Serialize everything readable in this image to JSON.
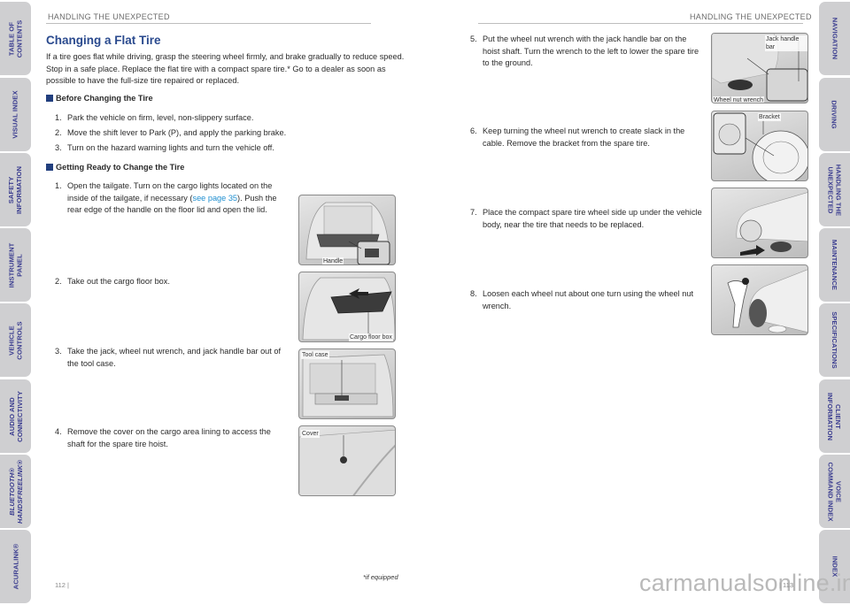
{
  "left_tabs": [
    {
      "label": "TABLE OF\nCONTENTS"
    },
    {
      "label": "VISUAL INDEX"
    },
    {
      "label": "SAFETY\nINFORMATION"
    },
    {
      "label": "INSTRUMENT\nPANEL"
    },
    {
      "label": "VEHICLE\nCONTROLS"
    },
    {
      "label": "AUDIO AND\nCONNECTIVITY"
    },
    {
      "label": "BLUETOOTH®\nHANDSFREELINK®"
    },
    {
      "label": "ACURALINK®"
    }
  ],
  "right_tabs": [
    {
      "label": "NAVIGATION"
    },
    {
      "label": "DRIVING"
    },
    {
      "label": "HANDLING THE\nUNEXPECTED"
    },
    {
      "label": "MAINTENANCE"
    },
    {
      "label": "SPECIFICATIONS"
    },
    {
      "label": "CLIENT\nINFORMATION"
    },
    {
      "label": "VOICE\nCOMMAND INDEX"
    },
    {
      "label": "INDEX"
    }
  ],
  "left_page": {
    "running_header": "HANDLING THE UNEXPECTED",
    "title": "Changing a Flat Tire",
    "intro": "If a tire goes flat while driving, grasp the steering wheel firmly, and brake gradually to reduce speed. Stop in a safe place. Replace the flat tire with a compact spare tire.* Go to a dealer as soon as possible to have the full-size tire repaired or replaced.",
    "section1": {
      "heading": "Before Changing the Tire",
      "steps": [
        {
          "num": "1.",
          "text": "Park the vehicle on firm, level, non-slippery surface."
        },
        {
          "num": "2.",
          "text": "Move the shift lever to Park (P), and apply the parking brake."
        },
        {
          "num": "3.",
          "text": "Turn on the hazard warning lights and turn the vehicle off."
        }
      ]
    },
    "section2": {
      "heading": "Getting Ready to Change the Tire",
      "steps": [
        {
          "num": "1.",
          "text_a": "Open the tailgate. Turn on the cargo lights located on the inside of the tailgate, if necessary (",
          "link": "see page 35",
          "text_b": "). Push the rear edge of the handle on the floor lid and open the lid.",
          "figure_label": "Handle"
        },
        {
          "num": "2.",
          "text": "Take out the cargo floor box.",
          "figure_label": "Cargo floor box"
        },
        {
          "num": "3.",
          "text": "Take the jack, wheel nut wrench, and jack handle bar out of the tool case.",
          "figure_label": "Tool case"
        },
        {
          "num": "4.",
          "text": "Remove the cover on the cargo area lining to access the shaft for the spare tire hoist.",
          "figure_label": "Cover"
        }
      ]
    },
    "footnote": "*if equipped",
    "page_number": "112  |"
  },
  "right_page": {
    "running_header": "HANDLING THE UNEXPECTED",
    "steps": [
      {
        "num": "5.",
        "text": "Put the wheel nut wrench with the jack handle bar on the hoist shaft. Turn the wrench to the left to lower the spare tire to the ground.",
        "figure_labels": [
          "Jack handle bar",
          "Wheel nut wrench"
        ]
      },
      {
        "num": "6.",
        "text": "Keep turning the wheel nut wrench to create slack in the cable. Remove the bracket from the spare tire.",
        "figure_labels": [
          "Bracket"
        ]
      },
      {
        "num": "7.",
        "text": "Place the compact spare tire wheel side up under the vehicle body, near the tire that needs to be replaced.",
        "figure_labels": []
      },
      {
        "num": "8.",
        "text": "Loosen each wheel nut about one turn using the wheel nut wrench.",
        "figure_labels": []
      }
    ],
    "page_number": "|  113"
  },
  "watermark": "carmanualsonline.info",
  "colors": {
    "title_blue": "#2a4a8e",
    "tab_text": "#3a3c8f",
    "tab_bg": "#cfcfd1",
    "link": "#1f8fd0",
    "section_square": "#223f7e"
  }
}
